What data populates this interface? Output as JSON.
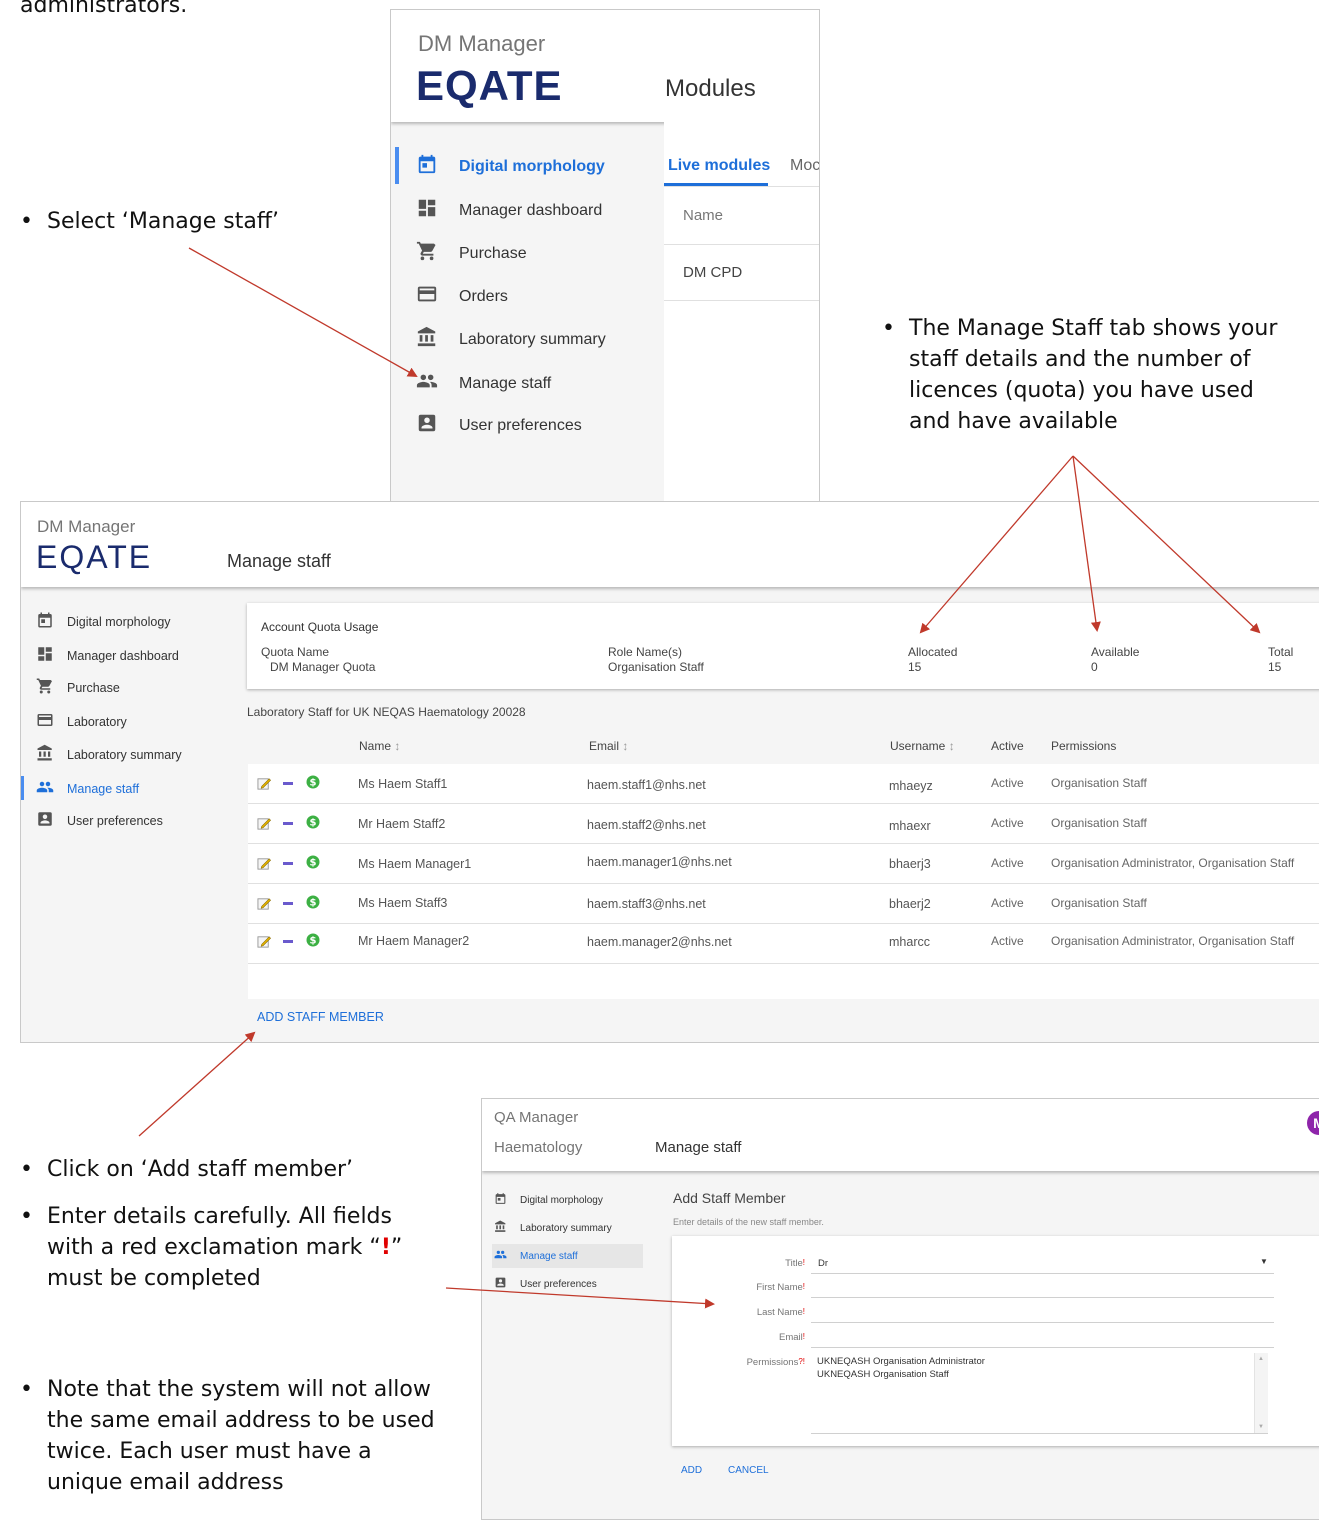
{
  "intro_text": "administrators.",
  "bullets": {
    "select": "Select ‘Manage staff’",
    "quota": [
      "The Manage Staff tab shows your",
      "staff details and the number of",
      "licences (quota) you have used",
      "and have available"
    ],
    "click_add": "Click on ‘Add staff member’",
    "enter_line1": "Enter details carefully. All fields",
    "enter_line2_pre": "with a red exclamation mark “",
    "enter_line2_mark": "!",
    "enter_line2_post": "”",
    "enter_line3": "must be completed",
    "note": [
      "Note that the system will not allow",
      "the same email address to be used",
      "twice. Each user must have a",
      "unique email address"
    ],
    "bullet_char": "•"
  },
  "shot1": {
    "subtitle": "DM Manager",
    "brand": "EQATE",
    "title": "Modules",
    "nav": [
      {
        "label": "Digital morphology",
        "icon": "calendar-icon"
      },
      {
        "label": "Manager dashboard",
        "icon": "dashboard-icon"
      },
      {
        "label": "Purchase",
        "icon": "cart-icon"
      },
      {
        "label": "Orders",
        "icon": "card-icon"
      },
      {
        "label": "Laboratory summary",
        "icon": "bank-icon"
      },
      {
        "label": "Manage staff",
        "icon": "people-icon"
      },
      {
        "label": "User preferences",
        "icon": "contact-icon"
      }
    ],
    "tabs": [
      "Live modules",
      "Moc"
    ],
    "table_header": "Name",
    "table_rows": [
      "DM CPD"
    ]
  },
  "shot2": {
    "subtitle": "DM Manager",
    "brand": "EQATE",
    "title": "Manage staff",
    "nav": [
      {
        "label": "Digital morphology",
        "icon": "calendar-icon"
      },
      {
        "label": "Manager dashboard",
        "icon": "dashboard-icon"
      },
      {
        "label": "Purchase",
        "icon": "cart-icon"
      },
      {
        "label": "Laboratory",
        "icon": "card-icon"
      },
      {
        "label": "Laboratory summary",
        "icon": "bank-icon"
      },
      {
        "label": "Manage staff",
        "icon": "people-icon"
      },
      {
        "label": "User preferences",
        "icon": "contact-icon"
      }
    ],
    "quota": {
      "heading": "Account Quota Usage",
      "quota_name_label": "Quota Name",
      "quota_name": "DM Manager Quota",
      "role_label": "Role Name(s)",
      "role": "Organisation Staff",
      "allocated_label": "Allocated",
      "allocated": "15",
      "available_label": "Available",
      "available": "0",
      "total_label": "Total",
      "total": "15"
    },
    "staff_heading": "Laboratory Staff for UK NEQAS Haematology 20028",
    "columns": {
      "name": "Name",
      "email": "Email",
      "username": "Username",
      "active": "Active",
      "permissions": "Permissions",
      "sort": "↕"
    },
    "rows": [
      {
        "name": "Ms Haem Staff1",
        "email": "haem.staff1@nhs.net",
        "username": "mhaeyz",
        "active": "Active",
        "permissions": "Organisation Staff"
      },
      {
        "name": "Mr Haem Staff2",
        "email": "haem.staff2@nhs.net",
        "username": "mhaexr",
        "active": "Active",
        "permissions": "Organisation Staff"
      },
      {
        "name": "Ms Haem Manager1",
        "email": "haem.manager1@nhs.net",
        "username": "bhaerj3",
        "active": "Active",
        "permissions": "Organisation Administrator, Organisation Staff"
      },
      {
        "name": "Ms Haem Staff3",
        "email": "haem.staff3@nhs.net",
        "username": "bhaerj2",
        "active": "Active",
        "permissions": "Organisation Staff"
      },
      {
        "name": "Mr Haem Manager2",
        "email": "haem.manager2@nhs.net",
        "username": "mharcc",
        "active": "Active",
        "permissions": "Organisation Administrator, Organisation Staff"
      }
    ],
    "add_button": "ADD STAFF MEMBER"
  },
  "shot3": {
    "subtitle": "QA Manager",
    "brand": "Haematology",
    "title": "Manage staff",
    "avatar": "M",
    "nav": [
      {
        "label": "Digital morphology",
        "icon": "calendar-icon"
      },
      {
        "label": "Laboratory summary",
        "icon": "bank-icon"
      },
      {
        "label": "Manage staff",
        "icon": "people-icon"
      },
      {
        "label": "User preferences",
        "icon": "contact-icon"
      }
    ],
    "form_title": "Add Staff Member",
    "form_subtitle": "Enter details of the new staff member.",
    "fields": {
      "title_label": "Title",
      "title_value": "Dr",
      "first_name_label": "First Name",
      "last_name_label": "Last Name",
      "email_label": "Email",
      "permissions_label": "Permissions",
      "permissions_req": "?!",
      "required_mark": "!"
    },
    "permission_options": [
      "UKNEQASH Organisation Administrator",
      "UKNEQASH Organisation Staff"
    ],
    "add": "ADD",
    "cancel": "CANCEL"
  },
  "colors": {
    "accent": "#1e6fd9",
    "brand": "#1a2b6d",
    "arrow": "#c0392b",
    "required": "#e00000",
    "avatar": "#8e24aa"
  }
}
